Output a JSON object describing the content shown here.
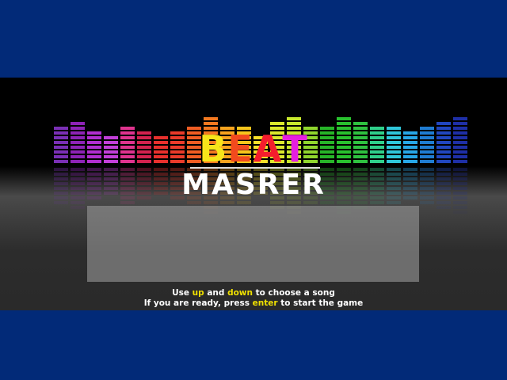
{
  "title": {
    "beat_letters": [
      {
        "char": "B",
        "color": "#f7e51a"
      },
      {
        "char": "E",
        "color": "#f24a1e"
      },
      {
        "char": "A",
        "color": "#f41d2d"
      },
      {
        "char": "T",
        "color": "#e61ee0"
      }
    ],
    "subtitle": "MASRER"
  },
  "instructions": {
    "line1": {
      "pre": "Use ",
      "key1": "up",
      "mid": " and ",
      "key2": "down",
      "post": " to choose a song"
    },
    "line2": {
      "pre": "If you are ready, press ",
      "key": "enter",
      "post": " to start the game"
    }
  },
  "equalizer": {
    "levels": [
      8,
      9,
      7,
      6,
      8,
      7,
      6,
      7,
      8,
      10,
      8,
      8,
      6,
      9,
      10,
      8,
      8,
      10,
      9,
      8,
      8,
      7,
      8,
      9,
      10
    ],
    "colors": [
      "#7a2fb5",
      "#8d23b6",
      "#b12ed0",
      "#c23fd8",
      "#e0338e",
      "#d2224e",
      "#e8302d",
      "#ea3b2a",
      "#f05d23",
      "#f37820",
      "#f8a41e",
      "#f7c51c",
      "#f6de2a",
      "#dbe82c",
      "#c7e82d",
      "#8fd52d",
      "#27b528",
      "#29c12e",
      "#2fc140",
      "#2fd08a",
      "#2fc7da",
      "#27a7e6",
      "#1f7cd2",
      "#2146bf",
      "#1e2fa6"
    ]
  },
  "colors": {
    "frame": "#022a78",
    "highlight_key": "#f0e000",
    "panel": "#969696"
  }
}
